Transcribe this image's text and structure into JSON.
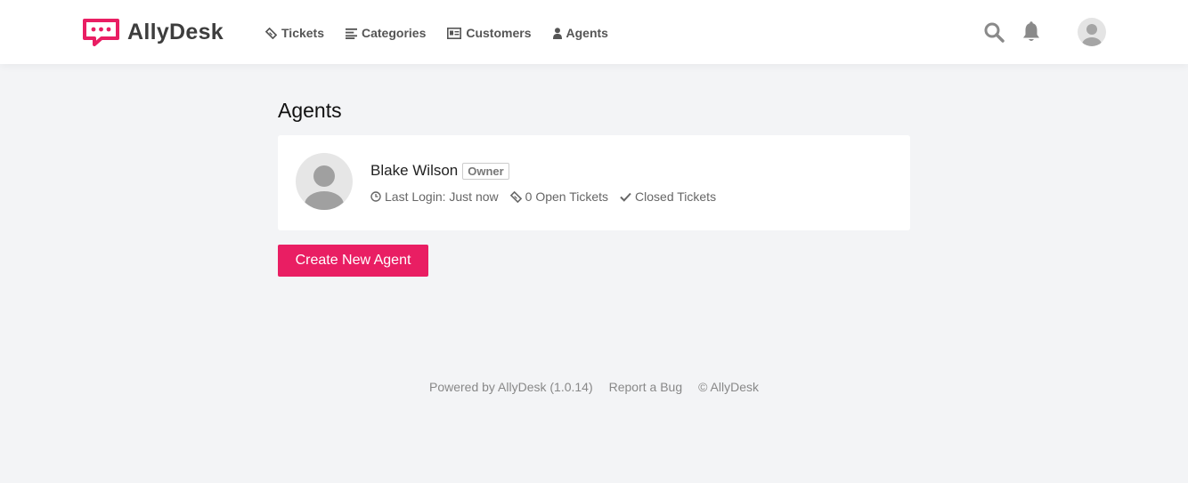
{
  "brand": {
    "name": "AllyDesk",
    "accent_color": "#e91e63"
  },
  "nav": {
    "items": [
      {
        "label": "Tickets",
        "icon": "ticket-icon"
      },
      {
        "label": "Categories",
        "icon": "list-icon"
      },
      {
        "label": "Customers",
        "icon": "id-card-icon"
      },
      {
        "label": "Agents",
        "icon": "user-icon"
      }
    ]
  },
  "header": {
    "search_icon": "search-icon",
    "notifications_icon": "bell-icon",
    "profile_icon": "user-avatar"
  },
  "page": {
    "title": "Agents"
  },
  "agents": [
    {
      "name": "Blake Wilson",
      "role": "Owner",
      "last_login": "Last Login: Just now",
      "open_tickets": "0 Open Tickets",
      "closed_tickets": "Closed Tickets"
    }
  ],
  "actions": {
    "create_agent_label": "Create New Agent"
  },
  "footer": {
    "powered_by": "Powered by AllyDesk (1.0.14)",
    "report_bug": "Report a Bug",
    "copyright": "© AllyDesk"
  }
}
